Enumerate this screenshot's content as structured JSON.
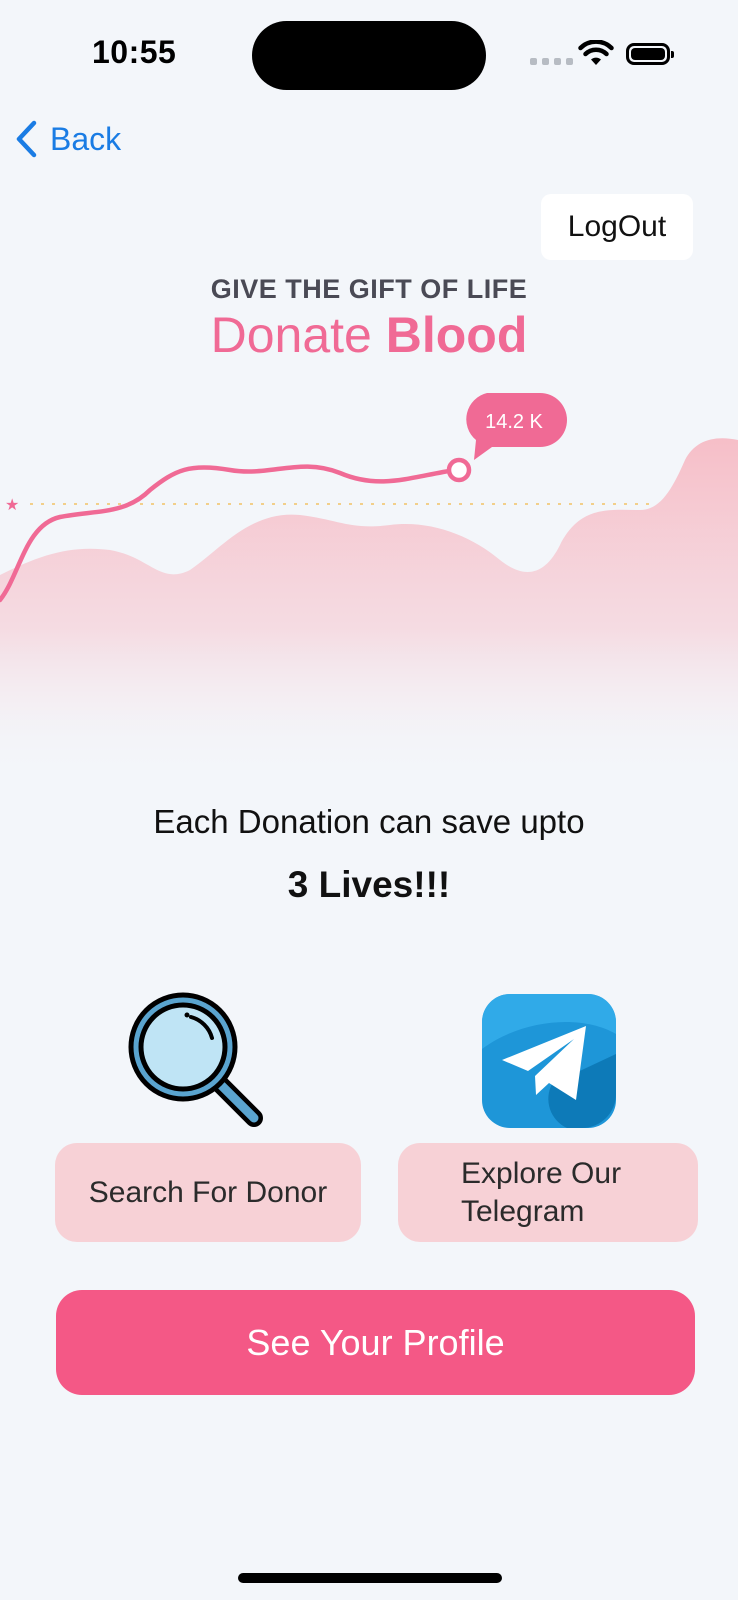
{
  "status_bar": {
    "time": "10:55"
  },
  "nav": {
    "back_label": "Back",
    "logout_label": "LogOut"
  },
  "hero": {
    "tagline": "GIVE THE GIFT OF LIFE",
    "headline_light": "Donate",
    "headline_bold": "Blood",
    "badge_value": "14.2 K"
  },
  "message": {
    "line1": "Each Donation can save upto",
    "line2": "3 Lives!!!"
  },
  "actions": {
    "search_label": "Search For Donor",
    "telegram_label": "Explore Our Telegram",
    "profile_label": "See Your Profile"
  },
  "colors": {
    "accent_pink": "#f45886",
    "card_pink": "#f7d1d6",
    "link_blue": "#1a7ce4",
    "background": "#f3f6fa"
  }
}
